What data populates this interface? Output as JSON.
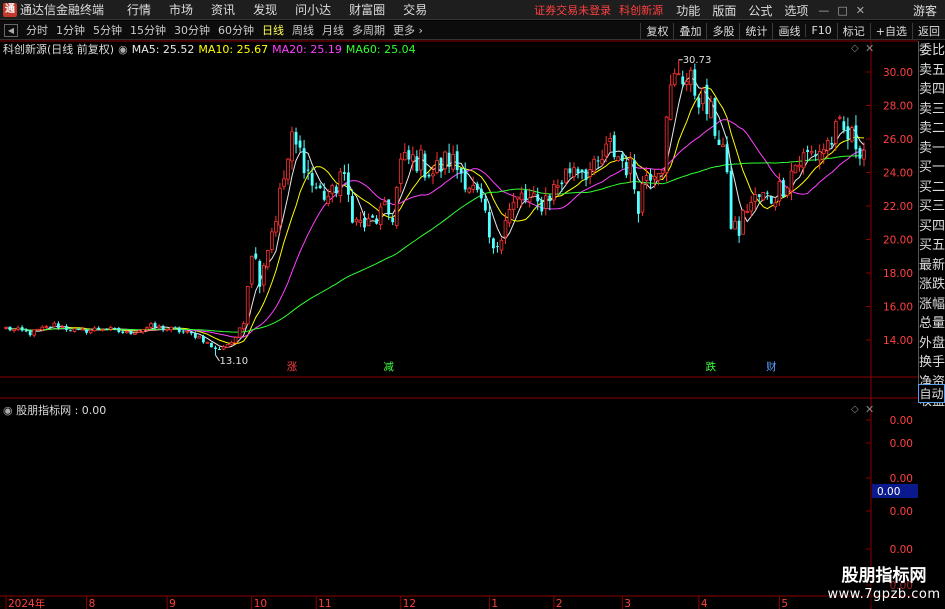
{
  "app": {
    "title": "通达信金融终端"
  },
  "menu": [
    "行情",
    "市场",
    "资讯",
    "发现",
    "问小达",
    "财富圈",
    "交易"
  ],
  "login_status": "证券交易未登录",
  "stock_name": "科创新源",
  "right_menu": [
    "功能",
    "版面",
    "公式",
    "选项"
  ],
  "guest_label": "游客",
  "window_controls": [
    "—",
    "□",
    "✕"
  ],
  "periods": [
    "分时",
    "1分钟",
    "5分钟",
    "15分钟",
    "30分钟",
    "60分钟",
    "日线",
    "周线",
    "月线",
    "多周期",
    "更多 ›"
  ],
  "active_period": "日线",
  "tool_buttons": [
    "复权",
    "叠加",
    "多股",
    "统计",
    "画线",
    "F10",
    "标记",
    "+自选",
    "返回"
  ],
  "main_legend": {
    "title": "科创新源(日线 前复权)",
    "ma5": "MA5: 25.52",
    "ma10": "MA10: 25.67",
    "ma20": "MA20: 25.19",
    "ma60": "MA60: 25.04"
  },
  "sub_legend": "股朋指标网 : 0.00",
  "right_panel": [
    "委比",
    "卖五",
    "卖四",
    "卖三",
    "卖二",
    "卖一",
    "买一",
    "买二",
    "买三",
    "买四",
    "买五",
    "最新",
    "涨跌",
    "涨幅",
    "总量",
    "外盘",
    "换手",
    "净资",
    "收益"
  ],
  "auto_button": "自动",
  "price_axis": [
    "30.00",
    "28.00",
    "26.00",
    "24.00",
    "22.00",
    "20.00",
    "18.00",
    "16.00",
    "14.00"
  ],
  "sub_axis": [
    "0.00",
    "0.00",
    "0.00",
    "0.00",
    "0.00",
    "0.00"
  ],
  "sub_axis_highlight": "0.00",
  "date_axis": [
    {
      "label": "2024年",
      "i": 0
    },
    {
      "label": "8",
      "i": 20
    },
    {
      "label": "9",
      "i": 40
    },
    {
      "label": "10",
      "i": 61
    },
    {
      "label": "11",
      "i": 77
    },
    {
      "label": "12",
      "i": 98
    },
    {
      "label": "1",
      "i": 120
    },
    {
      "label": "2",
      "i": 136
    },
    {
      "label": "3",
      "i": 153
    },
    {
      "label": "4",
      "i": 172
    },
    {
      "label": "5",
      "i": 192
    }
  ],
  "event_markers": [
    {
      "label": "涨",
      "i": 71,
      "color": "#ff4040"
    },
    {
      "label": "减",
      "i": 95,
      "color": "#40ff40"
    },
    {
      "label": "跌",
      "i": 175,
      "color": "#40ff40"
    },
    {
      "label": "财",
      "i": 190,
      "color": "#5aa0ff"
    }
  ],
  "price_labels": {
    "high": "30.73",
    "low": "13.10"
  },
  "watermark": {
    "line1": "股朋指标网",
    "line2": "www.7gpzb.com"
  },
  "colors": {
    "up": "#ff3232",
    "down": "#54ffff",
    "ma5": "#e8e8e8",
    "ma10": "#ffff00",
    "ma20": "#ff40ff",
    "ma60": "#30ff30",
    "grid": "#8b0000"
  },
  "chart_data": {
    "type": "candlestick",
    "anchors": [
      [
        0,
        14.7
      ],
      [
        6,
        14.4
      ],
      [
        12,
        14.9
      ],
      [
        18,
        14.5
      ],
      [
        24,
        14.7
      ],
      [
        30,
        14.4
      ],
      [
        36,
        14.8
      ],
      [
        42,
        14.6
      ],
      [
        48,
        14.2
      ],
      [
        52,
        13.4
      ],
      [
        57,
        14.0
      ],
      [
        59,
        15.5
      ],
      [
        61,
        19.5
      ],
      [
        63,
        17.8
      ],
      [
        67,
        21.5
      ],
      [
        71,
        25.8
      ],
      [
        74,
        24.8
      ],
      [
        76,
        23.3
      ],
      [
        78,
        22.8
      ],
      [
        81,
        22.5
      ],
      [
        83,
        24.0
      ],
      [
        85,
        22.5
      ],
      [
        87,
        21.0
      ],
      [
        90,
        20.8
      ],
      [
        93,
        21.5
      ],
      [
        96,
        21.5
      ],
      [
        98,
        24.5
      ],
      [
        102,
        24.8
      ],
      [
        106,
        24.0
      ],
      [
        110,
        24.8
      ],
      [
        114,
        23.8
      ],
      [
        118,
        22.0
      ],
      [
        121,
        19.0
      ],
      [
        124,
        21.5
      ],
      [
        128,
        22.5
      ],
      [
        132,
        22.0
      ],
      [
        136,
        23.0
      ],
      [
        141,
        24.5
      ],
      [
        146,
        24.0
      ],
      [
        150,
        25.5
      ],
      [
        155,
        24.2
      ],
      [
        157,
        22.3
      ],
      [
        159,
        24.0
      ],
      [
        163,
        24.8
      ],
      [
        165,
        28.8
      ],
      [
        167,
        30.2
      ],
      [
        169,
        29.5
      ],
      [
        172,
        28.7
      ],
      [
        175,
        27.3
      ],
      [
        178,
        25.5
      ],
      [
        180,
        21.0
      ],
      [
        182,
        20.5
      ],
      [
        184,
        22.0
      ],
      [
        187,
        22.5
      ],
      [
        190,
        22.5
      ],
      [
        193,
        23.3
      ],
      [
        196,
        24.5
      ],
      [
        199,
        25.0
      ],
      [
        203,
        25.5
      ],
      [
        207,
        26.5
      ],
      [
        211,
        25.8
      ],
      [
        213,
        25.5
      ]
    ],
    "n": 214,
    "ylim": [
      13.0,
      31.2
    ],
    "high": 30.73,
    "low": 13.1
  }
}
